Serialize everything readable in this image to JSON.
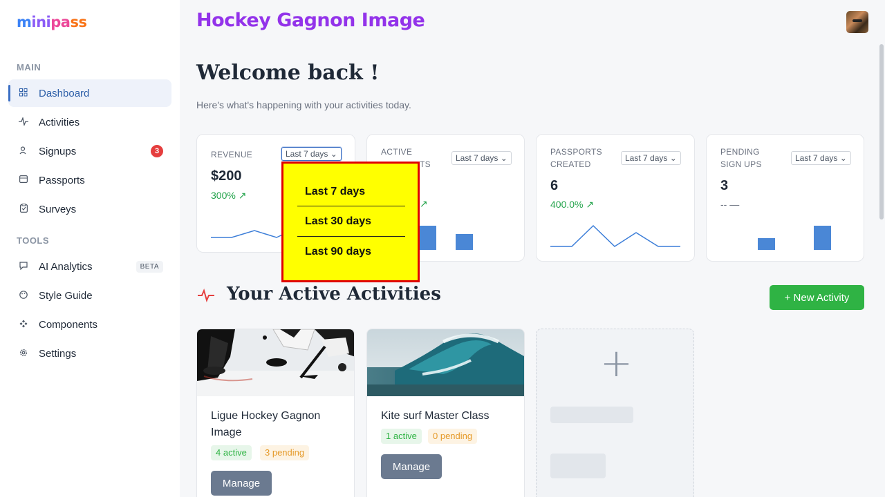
{
  "brand": {
    "logo_parts": [
      "m",
      "ini",
      "pa",
      "ss"
    ]
  },
  "sidebar": {
    "main_label": "MAIN",
    "tools_label": "TOOLS",
    "main_items": [
      {
        "label": "Dashboard",
        "icon": "grid-icon",
        "active": true
      },
      {
        "label": "Activities",
        "icon": "pulse-icon"
      },
      {
        "label": "Signups",
        "icon": "user-icon",
        "badge": "3"
      },
      {
        "label": "Passports",
        "icon": "ticket-icon"
      },
      {
        "label": "Surveys",
        "icon": "clipboard-icon"
      }
    ],
    "tools_items": [
      {
        "label": "AI Analytics",
        "icon": "chat-icon",
        "badge": "BETA"
      },
      {
        "label": "Style Guide",
        "icon": "palette-icon"
      },
      {
        "label": "Components",
        "icon": "components-icon"
      },
      {
        "label": "Settings",
        "icon": "gear-icon"
      }
    ]
  },
  "header": {
    "org_title": "Hockey Gagnon Image"
  },
  "welcome": {
    "title": "Welcome back !",
    "subtitle": "Here's what's happening with your activities today."
  },
  "stats": [
    {
      "label": "REVENUE",
      "range": "Last 7 days",
      "value": "$200",
      "change": "300%",
      "trend": "up"
    },
    {
      "label": "ACTIVE PASSPORTS",
      "label_visible_1": "ACTIVE",
      "label_visible_2": "TS",
      "range": "Last 7 days",
      "trend": "up"
    },
    {
      "label": "PASSPORTS CREATED",
      "range": "Last 7 days",
      "value": "6",
      "change": "400.0%",
      "trend": "up"
    },
    {
      "label": "PENDING SIGN UPS",
      "range": "Last 7 days",
      "value": "3",
      "change": "-- —",
      "trend": "neutral"
    }
  ],
  "dropdown": {
    "options": [
      "Last 7 days",
      "Last 30 days",
      "Last 90 days"
    ]
  },
  "activities": {
    "section_title": "Your Active Activities",
    "new_button": "+ New Activity",
    "items": [
      {
        "name": "Ligue Hockey Gagnon Image",
        "active": "4 active",
        "pending": "3 pending",
        "manage": "Manage"
      },
      {
        "name": "Kite surf Master Class",
        "active": "1 active",
        "pending": "0 pending",
        "manage": "Manage"
      }
    ]
  },
  "colors": {
    "accent": "#3b6fc4",
    "success": "#2fb344",
    "danger": "#e53e3e",
    "dropdown_bg": "#ffff00",
    "dropdown_border": "#e00000",
    "org_title": "#9333ea"
  }
}
